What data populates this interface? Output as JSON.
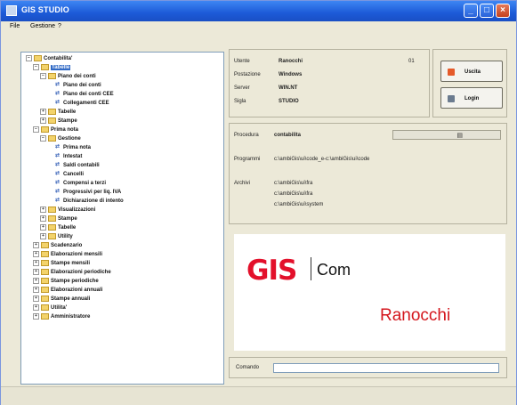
{
  "window": {
    "title": "GIS STUDIO"
  },
  "menu": {
    "items": [
      "File",
      "Gestione",
      "?"
    ]
  },
  "tree": {
    "nodes": [
      {
        "label": "Contabilita'",
        "level": 0,
        "kind": "folder",
        "expander": "−"
      },
      {
        "label": "Tabelle",
        "level": 1,
        "kind": "folder",
        "expander": "−",
        "selected": true
      },
      {
        "label": "Piano dei conti",
        "level": 2,
        "kind": "folder",
        "expander": "−"
      },
      {
        "label": "Piano dei conti",
        "level": 3,
        "kind": "doc"
      },
      {
        "label": "Piano dei conti CEE",
        "level": 3,
        "kind": "doc"
      },
      {
        "label": "Collegamenti CEE",
        "level": 3,
        "kind": "doc"
      },
      {
        "label": "Tabelle",
        "level": 2,
        "kind": "folder",
        "expander": "+"
      },
      {
        "label": "Stampe",
        "level": 2,
        "kind": "folder",
        "expander": "+"
      },
      {
        "label": "Prima nota",
        "level": 1,
        "kind": "folder",
        "expander": "−"
      },
      {
        "label": "Gestione",
        "level": 2,
        "kind": "folder",
        "expander": "−"
      },
      {
        "label": "Prima nota",
        "level": 3,
        "kind": "doc"
      },
      {
        "label": "Intestat",
        "level": 3,
        "kind": "doc"
      },
      {
        "label": "Saldi contabili",
        "level": 3,
        "kind": "doc"
      },
      {
        "label": "Cancelli",
        "level": 3,
        "kind": "doc"
      },
      {
        "label": "Compensi a terzi",
        "level": 3,
        "kind": "doc"
      },
      {
        "label": "Progressivi per liq. IVA",
        "level": 3,
        "kind": "doc"
      },
      {
        "label": "Dichiarazione di intento",
        "level": 3,
        "kind": "doc"
      },
      {
        "label": "Visualizzazioni",
        "level": 2,
        "kind": "folder",
        "expander": "+"
      },
      {
        "label": "Stampe",
        "level": 2,
        "kind": "folder",
        "expander": "+"
      },
      {
        "label": "Tabelle",
        "level": 2,
        "kind": "folder",
        "expander": "+"
      },
      {
        "label": "Utility",
        "level": 2,
        "kind": "folder",
        "expander": "+"
      },
      {
        "label": "Scadenzario",
        "level": 1,
        "kind": "folder",
        "expander": "+"
      },
      {
        "label": "Elaborazioni mensili",
        "level": 1,
        "kind": "folder",
        "expander": "+"
      },
      {
        "label": "Stampe mensili",
        "level": 1,
        "kind": "folder",
        "expander": "+"
      },
      {
        "label": "Elaborazioni periodiche",
        "level": 1,
        "kind": "folder",
        "expander": "+"
      },
      {
        "label": "Stampe periodiche",
        "level": 1,
        "kind": "folder",
        "expander": "+"
      },
      {
        "label": "Elaborazioni annuali",
        "level": 1,
        "kind": "folder",
        "expander": "+"
      },
      {
        "label": "Stampe annuali",
        "level": 1,
        "kind": "folder",
        "expander": "+"
      },
      {
        "label": "Utilita'",
        "level": 1,
        "kind": "folder",
        "expander": "+"
      },
      {
        "label": "Amministratore",
        "level": 1,
        "kind": "folder",
        "expander": "+"
      }
    ]
  },
  "info": {
    "utente_label": "Utente",
    "utente_value": "Ranocchi",
    "postazione_label": "Postazione",
    "postazione_value": "Windows",
    "server_label": "Server",
    "server_value": "WIN.NT",
    "sigla_label": "Sigla",
    "sigla_value": "STUDIO",
    "id_value": "01"
  },
  "buttons": {
    "exit_label": "Uscita",
    "login_label": "Login"
  },
  "process": {
    "procedura_label": "Procedura",
    "procedura_value": "contabilita",
    "programmi_label": "Programmi",
    "programmi_value": "c:\\ambiGis\\ui\\code_e-c:\\ambiGis\\ui\\code",
    "archivi_label": "Archivi",
    "archivi_values": [
      "c:\\ambiGis\\ui\\fra",
      "c:\\ambiGis\\ui\\fra",
      "c:\\ambiGis\\ui\\system"
    ]
  },
  "logo": {
    "brand": "GIS",
    "product": "Com",
    "company": "Ranocchi"
  },
  "command": {
    "label": "Comando",
    "value": ""
  },
  "colors": {
    "title_blue": "#1c5ad8",
    "selection": "#316ac5",
    "logo_red": "#e3102b",
    "face": "#ece9d8"
  }
}
